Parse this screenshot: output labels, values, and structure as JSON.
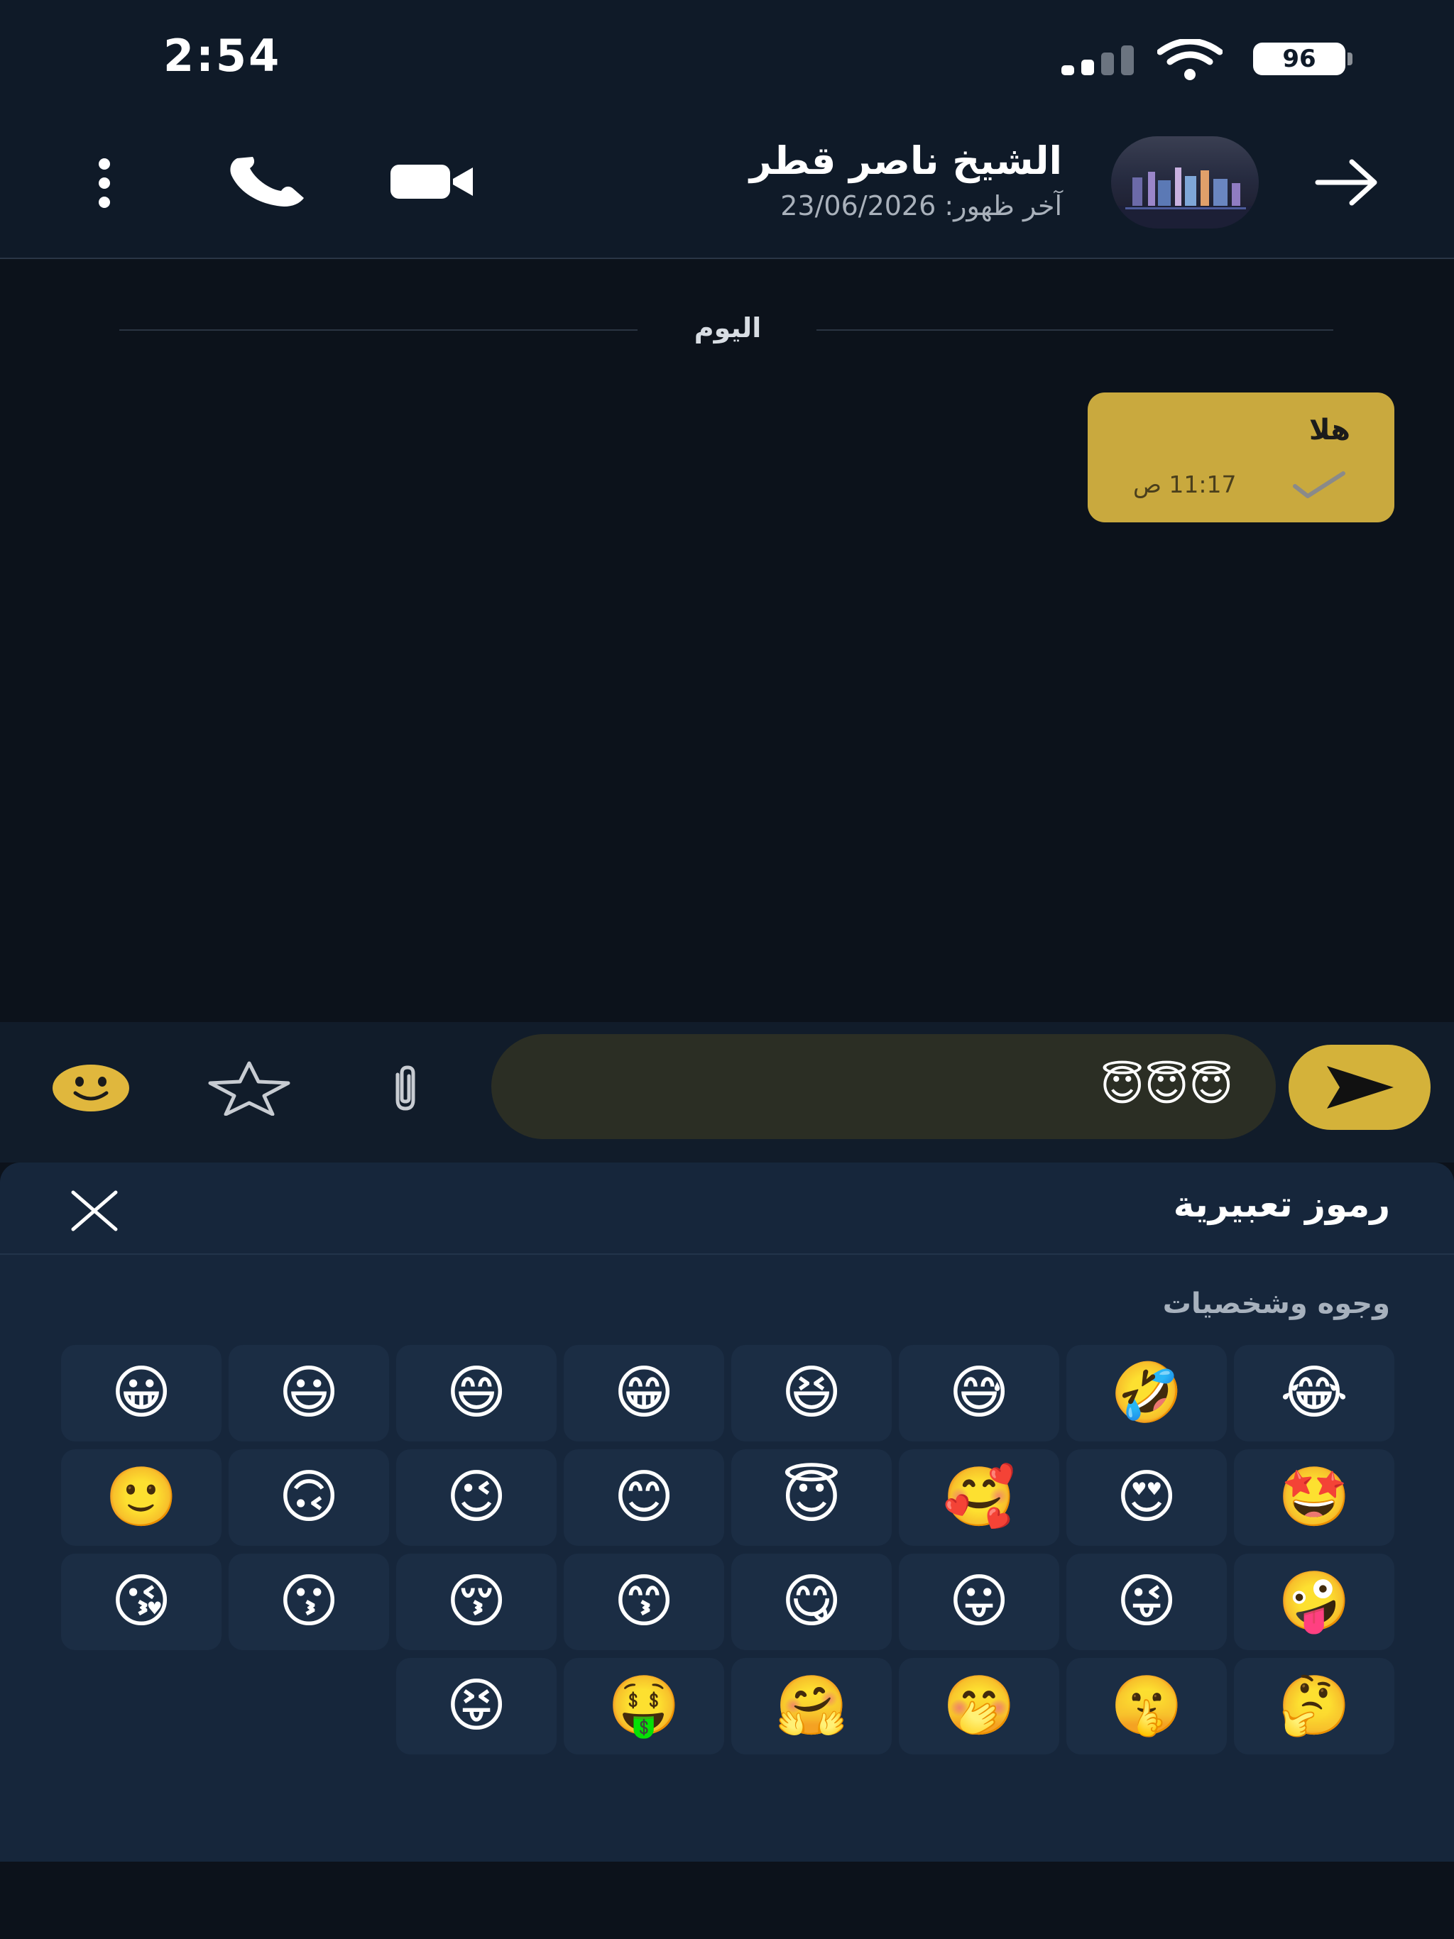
{
  "status_bar": {
    "time": "2:54",
    "battery": "96"
  },
  "header": {
    "contact_name": "الشيخ ناصر قطر",
    "last_seen": "آخر ظهور: 23/06/2026"
  },
  "chat": {
    "date_separator": "اليوم",
    "messages": [
      {
        "text": "هلا",
        "time": "11:17 ص",
        "status": "sent"
      }
    ]
  },
  "composer": {
    "value": "😇😇😇"
  },
  "emoji_panel": {
    "title": "رموز تعبيرية",
    "category": "وجوه وشخصيات",
    "emojis": [
      "😂",
      "🤣",
      "😅",
      "😆",
      "😁",
      "😄",
      "😃",
      "😀",
      "🤩",
      "😍",
      "🥰",
      "😇",
      "😊",
      "😉",
      "🙃",
      "🙂",
      "🤪",
      "😜",
      "😛",
      "😋",
      "😙",
      "😚",
      "😗",
      "😘",
      "🤔",
      "🤫",
      "🤭",
      "🤗",
      "🤑",
      "😝"
    ]
  },
  "colors": {
    "accent": "#d4b23a",
    "bubble": "#c9a93e",
    "background": "#0c121b",
    "panel": "#16263b"
  }
}
